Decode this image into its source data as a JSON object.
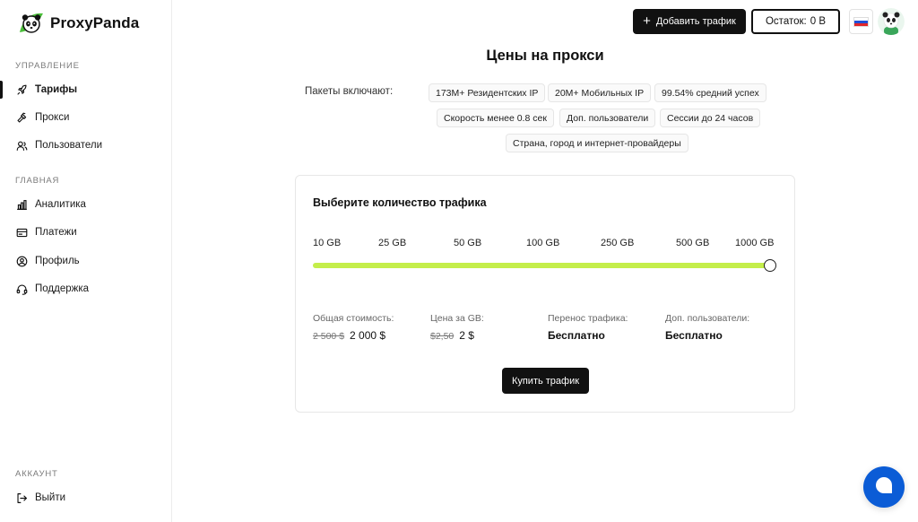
{
  "brand": {
    "name": "ProxyPanda"
  },
  "sidebar": {
    "sections": [
      {
        "label": "УПРАВЛЕНИЕ"
      },
      {
        "label": "ГЛАВНАЯ"
      },
      {
        "label": "АККАУНТ"
      }
    ],
    "items": [
      {
        "label": "Тарифы",
        "icon": "rocket-icon",
        "active": true
      },
      {
        "label": "Прокси",
        "icon": "hammer-icon"
      },
      {
        "label": "Пользователи",
        "icon": "users-icon"
      },
      {
        "label": "Аналитика",
        "icon": "bar-chart-icon"
      },
      {
        "label": "Платежи",
        "icon": "receipt-icon"
      },
      {
        "label": "Профиль",
        "icon": "user-circle-icon"
      },
      {
        "label": "Поддержка",
        "icon": "headset-icon"
      },
      {
        "label": "Выйти",
        "icon": "logout-icon"
      }
    ]
  },
  "header": {
    "add_traffic": "Добавить трафик",
    "balance_label": "Остаток:",
    "balance_value": "0 B",
    "language": "ru"
  },
  "page": {
    "title": "Цены на прокси",
    "includes_label": "Пакеты включают:",
    "features": [
      "173M+ Резидентских IP",
      "20M+ Мобильных IP",
      "99.54% средний успех",
      "Скорость менее 0.8 сек",
      "Доп. пользователи",
      "Сессии до 24 часов",
      "Страна, город и интернет-провайдеры"
    ]
  },
  "traffic": {
    "title": "Выберите количество трафика",
    "options": [
      "10 GB",
      "25 GB",
      "50 GB",
      "100 GB",
      "250 GB",
      "500 GB",
      "1000 GB"
    ],
    "selected": "1000 GB",
    "stats": {
      "total_label": "Общая стоимость:",
      "total_old": "2 500 $",
      "total_new": "2 000 $",
      "per_gb_label": "Цена за GB:",
      "per_gb_old": "$2,50",
      "per_gb_new": "2 $",
      "rollover_label": "Перенос трафика:",
      "rollover_value": "Бесплатно",
      "extra_users_label": "Доп. пользователи:",
      "extra_users_value": "Бесплатно"
    },
    "buy_label": "Купить трафик"
  },
  "colors": {
    "accent_fill": "#c4ee4a",
    "primary": "#111111",
    "chat": "#0b5cd6"
  }
}
